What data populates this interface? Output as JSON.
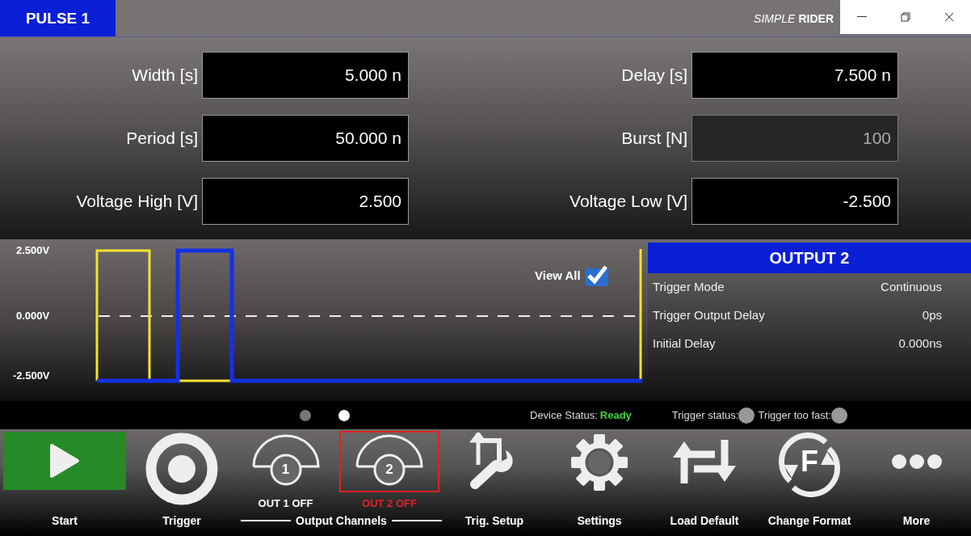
{
  "window": {
    "title": "PULSE 1",
    "brand_light": "SIMPLE",
    "brand_bold": "RIDER"
  },
  "parameters": [
    {
      "label": "Width [s]",
      "value": "5.000 n",
      "disabled": false
    },
    {
      "label": "Delay [s]",
      "value": "7.500 n",
      "disabled": false
    },
    {
      "label": "Period [s]",
      "value": "50.000 n",
      "disabled": false
    },
    {
      "label": "Burst [N]",
      "value": "100",
      "disabled": true
    },
    {
      "label": "Voltage High [V]",
      "value": "2.500",
      "disabled": false
    },
    {
      "label": "Voltage Low [V]",
      "value": "-2.500",
      "disabled": false
    }
  ],
  "waveform": {
    "y_labels": [
      "2.500V",
      "0.000V",
      "-2.500V"
    ],
    "traces": [
      {
        "color": "#f2e233"
      },
      {
        "color": "#1530e6"
      }
    ],
    "view_all": {
      "label": "View All",
      "checked": true
    },
    "pages": [
      {
        "selected": false
      },
      {
        "selected": true
      }
    ]
  },
  "output_panel": {
    "title": "OUTPUT 2",
    "rows": [
      {
        "label": "Trigger Mode",
        "value": "Continuous"
      },
      {
        "label": "Trigger Output Delay",
        "value": "0ps"
      },
      {
        "label": "Initial Delay",
        "value": "0.000ns"
      }
    ]
  },
  "status": {
    "device_label": "Device Status:",
    "device_value": "Ready",
    "trigger_status": "Trigger status:",
    "trigger_too_fast": "Trigger too fast:"
  },
  "toolbar": [
    {
      "kind": "start",
      "label": "Start"
    },
    {
      "kind": "trigger",
      "label": "Trigger"
    },
    {
      "kind": "output",
      "label": "OUT 1 OFF",
      "glyph": "1",
      "selected": false
    },
    {
      "kind": "output",
      "label": "OUT 2 OFF",
      "glyph": "2",
      "selected": true
    },
    {
      "kind": "trig-setup",
      "label": "Trig. Setup"
    },
    {
      "kind": "settings",
      "label": "Settings"
    },
    {
      "kind": "load-default",
      "label": "Load Default"
    },
    {
      "kind": "change-format",
      "label": "Change Format",
      "glyph": "F"
    },
    {
      "kind": "more",
      "label": "More"
    }
  ],
  "output_group_label": "Output Channels"
}
